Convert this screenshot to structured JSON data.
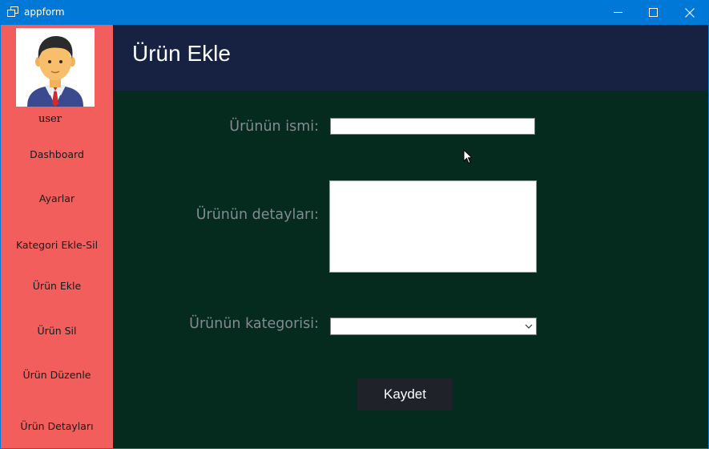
{
  "window": {
    "title": "appform",
    "icon": "app-window-icon",
    "controls": [
      "minimize-icon",
      "maximize-icon",
      "close-icon"
    ],
    "accent_color": "#0078d7"
  },
  "sidebar": {
    "background": "#f15e5b",
    "user_label": "user",
    "avatar_icon": "user-avatar-icon",
    "items": [
      {
        "label": "Dashboard"
      },
      {
        "label": "Ayarlar"
      },
      {
        "label": "Kategori Ekle-Sil"
      },
      {
        "label": "Ürün Ekle"
      },
      {
        "label": "Ürün Sil"
      },
      {
        "label": "Ürün Düzenle"
      },
      {
        "label": "Ürün Detayları"
      }
    ]
  },
  "header": {
    "title": "Ürün Ekle",
    "background": "#172243"
  },
  "form": {
    "background": "#042b1e",
    "name_label": "Ürünün ismi:",
    "name_value": "",
    "details_label": "Ürünün detayları:",
    "details_value": "",
    "category_label": "Ürünün kategorisi:",
    "category_value": "",
    "save_label": "Kaydet"
  }
}
